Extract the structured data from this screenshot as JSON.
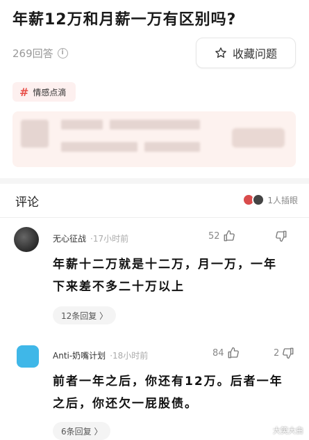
{
  "question": {
    "title": "年薪12万和月薪一万有区别吗?",
    "answer_count": "269回答",
    "info_icon": "info-icon",
    "collect_label": "收藏问题",
    "collect_icon": "star-icon"
  },
  "topic_tag": {
    "hash": "#",
    "label": "情感点滴",
    "hash_color": "#e8504a"
  },
  "comments_section": {
    "heading": "评论",
    "likers_label": "1人插眼"
  },
  "comments": [
    {
      "username": "无心征战",
      "time": "17小时前",
      "likes": "52",
      "dislikes": "",
      "text": "年薪十二万就是十二万，月一万，一年下来差不多二十万以上",
      "replies": "12条回复 〉"
    },
    {
      "username": "Anti-奶嘴计划",
      "time": "18小时前",
      "likes": "84",
      "dislikes": "2",
      "text": "前者一年之后，你还有12万。后者一年之后，你还欠一屁股债。",
      "replies": "6条回复 〉"
    }
  ],
  "watermark": "大笑大白"
}
